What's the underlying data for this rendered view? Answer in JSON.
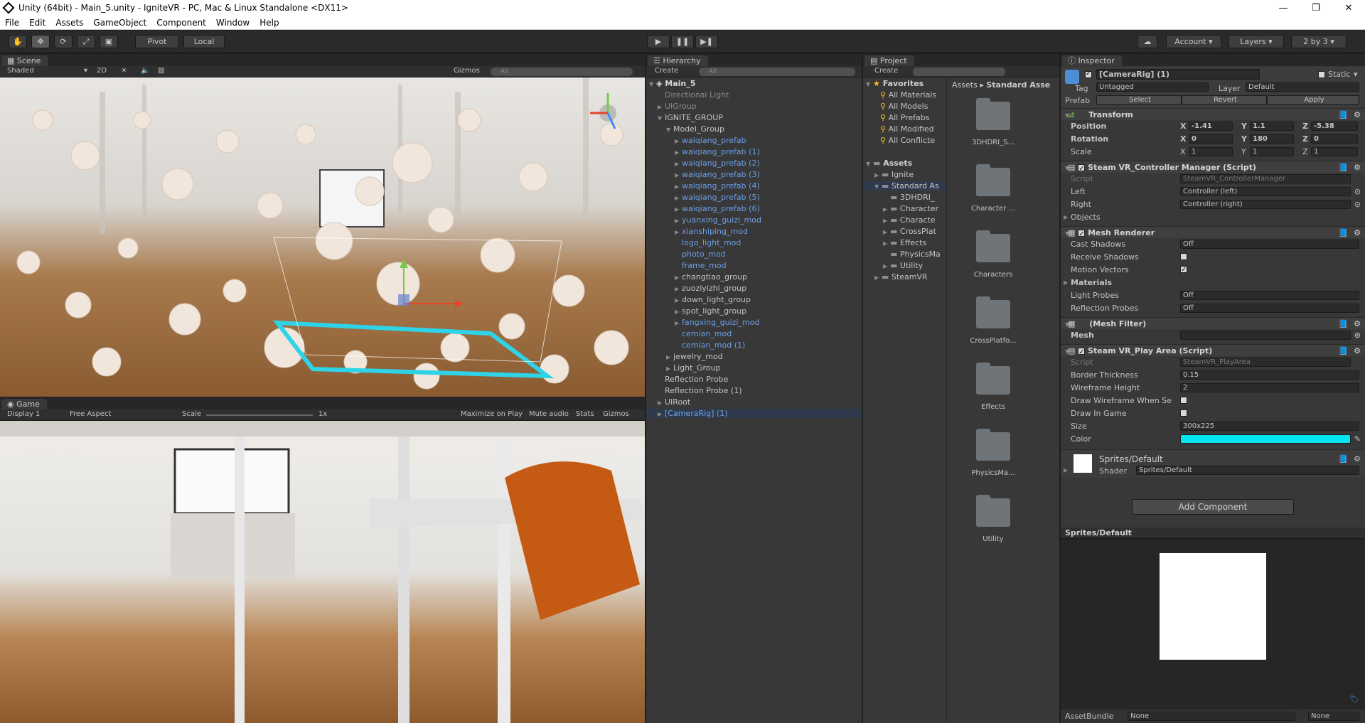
{
  "window": {
    "title": "Unity (64bit) - Main_5.unity - IgniteVR - PC, Mac & Linux Standalone <DX11>",
    "minimize": "—",
    "restore": "❐",
    "close": "✕"
  },
  "menu": [
    "File",
    "Edit",
    "Assets",
    "GameObject",
    "Component",
    "Window",
    "Help"
  ],
  "toolbar": {
    "pivot": "Pivot",
    "local": "Local",
    "account": "Account",
    "layers": "Layers",
    "layout": "2 by 3"
  },
  "scene": {
    "tab": "Scene",
    "shading": "Shaded",
    "mode2d": "2D",
    "gizmos": "Gizmos",
    "search_placeholder": "All"
  },
  "game": {
    "tab": "Game",
    "display": "Display 1",
    "aspect": "Free Aspect",
    "scale_label": "Scale",
    "scale_value": "1x",
    "maximize": "Maximize on Play",
    "mute": "Mute audio",
    "stats": "Stats",
    "gizmos": "Gizmos"
  },
  "hierarchy": {
    "tab": "Hierarchy",
    "create": "Create",
    "search_placeholder": "All",
    "scene_name": "Main_5",
    "rows": [
      {
        "label": "Directional Light",
        "color": "gray",
        "arrow": ""
      },
      {
        "label": "UIGroup",
        "color": "gray",
        "arrow": "▶"
      },
      {
        "label": "IGNITE_GROUP",
        "color": "normal",
        "arrow": "▼"
      },
      {
        "label": "Model_Group",
        "color": "normal",
        "arrow": "▼"
      },
      {
        "label": "waiqiang_prefab",
        "color": "blue",
        "arrow": "▶"
      },
      {
        "label": "waiqiang_prefab (1)",
        "color": "blue",
        "arrow": "▶"
      },
      {
        "label": "waiqiang_prefab (2)",
        "color": "blue",
        "arrow": "▶"
      },
      {
        "label": "waiqiang_prefab (3)",
        "color": "blue",
        "arrow": "▶"
      },
      {
        "label": "waiqiang_prefab (4)",
        "color": "blue",
        "arrow": "▶"
      },
      {
        "label": "waiqiang_prefab (5)",
        "color": "blue",
        "arrow": "▶"
      },
      {
        "label": "waiqiang_prefab (6)",
        "color": "blue",
        "arrow": "▶"
      },
      {
        "label": "yuanxing_guizi_mod",
        "color": "blue",
        "arrow": "▶"
      },
      {
        "label": "xianshiping_mod",
        "color": "blue",
        "arrow": "▶"
      },
      {
        "label": "logo_light_mod",
        "color": "blue",
        "arrow": ""
      },
      {
        "label": "photo_mod",
        "color": "blue",
        "arrow": ""
      },
      {
        "label": "frame_mod",
        "color": "blue",
        "arrow": ""
      },
      {
        "label": "changtiao_group",
        "color": "normal",
        "arrow": "▶"
      },
      {
        "label": "zuoziyizhi_group",
        "color": "normal",
        "arrow": "▶"
      },
      {
        "label": "down_light_group",
        "color": "normal",
        "arrow": "▶"
      },
      {
        "label": "spot_light_group",
        "color": "normal",
        "arrow": "▶"
      },
      {
        "label": "fangxing_guizi_mod",
        "color": "blue",
        "arrow": "▶"
      },
      {
        "label": "cemian_mod",
        "color": "blue",
        "arrow": ""
      },
      {
        "label": "cemian_mod (1)",
        "color": "blue",
        "arrow": ""
      },
      {
        "label": "jewelry_mod",
        "color": "normal",
        "arrow": "▶"
      },
      {
        "label": "Light_Group",
        "color": "normal",
        "arrow": "▶"
      },
      {
        "label": "Reflection Probe",
        "color": "normal",
        "arrow": ""
      },
      {
        "label": "Reflection Probe (1)",
        "color": "normal",
        "arrow": ""
      },
      {
        "label": "UIRoot",
        "color": "normal",
        "arrow": "▶"
      },
      {
        "label": "[CameraRig] (1)",
        "color": "blue",
        "arrow": "▶"
      }
    ]
  },
  "project": {
    "tab": "Project",
    "create": "Create",
    "favorites_title": "Favorites",
    "favorites": [
      "All Materials",
      "All Models",
      "All Prefabs",
      "All Modified",
      "All Conflicte"
    ],
    "assets_title": "Assets",
    "assets": [
      {
        "label": "Ignite",
        "arrow": "▶"
      },
      {
        "label": "Standard As",
        "arrow": "▼"
      },
      {
        "label": "3DHDRI_",
        "arrow": ""
      },
      {
        "label": "Character",
        "arrow": "▶"
      },
      {
        "label": "Characte",
        "arrow": "▶"
      },
      {
        "label": "CrossPlat",
        "arrow": "▶"
      },
      {
        "label": "Effects",
        "arrow": "▶"
      },
      {
        "label": "PhysicsMa",
        "arrow": ""
      },
      {
        "label": "Utility",
        "arrow": "▶"
      },
      {
        "label": "SteamVR",
        "arrow": "▶"
      }
    ],
    "breadcrumb_root": "Assets",
    "breadcrumb_sep": "▸",
    "breadcrumb_current": "Standard Asse",
    "folders": [
      "3DHDRI_S...",
      "Character ...",
      "Characters",
      "CrossPlatfo...",
      "Effects",
      "PhysicsMa...",
      "Utility"
    ]
  },
  "inspector": {
    "tab": "Inspector",
    "object_name": "[CameraRig] (1)",
    "static_label": "Static",
    "tag_label": "Tag",
    "tag_value": "Untagged",
    "layer_label": "Layer",
    "layer_value": "Default",
    "prefab_label": "Prefab",
    "prefab_select": "Select",
    "prefab_revert": "Revert",
    "prefab_apply": "Apply",
    "transform": {
      "title": "Transform",
      "position_label": "Position",
      "px": "-1.41",
      "py": "1.1",
      "pz": "-5.38",
      "rotation_label": "Rotation",
      "rx": "0",
      "ry": "180",
      "rz": "0",
      "scale_label": "Scale",
      "sx": "1",
      "sy": "1",
      "sz": "1"
    },
    "controller": {
      "title": "Steam VR_Controller Manager (Script)",
      "script_label": "Script",
      "script_value": "SteamVR_ControllerManager",
      "left_label": "Left",
      "left_value": "Controller (left)",
      "right_label": "Right",
      "right_value": "Controller (right)",
      "objects_label": "Objects"
    },
    "mesh_renderer": {
      "title": "Mesh Renderer",
      "cast_label": "Cast Shadows",
      "cast_value": "Off",
      "receive_label": "Receive Shadows",
      "motion_label": "Motion Vectors",
      "materials_label": "Materials",
      "light_label": "Light Probes",
      "light_value": "Off",
      "reflection_label": "Reflection Probes",
      "reflection_value": "Off"
    },
    "mesh_filter": {
      "title": "(Mesh Filter)",
      "mesh_label": "Mesh"
    },
    "play_area": {
      "title": "Steam VR_Play Area (Script)",
      "script_label": "Script",
      "script_value": "SteamVR_PlayArea",
      "border_label": "Border Thickness",
      "border_value": "0.15",
      "wire_label": "Wireframe Height",
      "wire_value": "2",
      "draw_wire_label": "Draw Wireframe When Se",
      "draw_game_label": "Draw In Game",
      "size_label": "Size",
      "size_value": "300x225",
      "color_label": "Color",
      "color_hex": "#00e5ee"
    },
    "material": {
      "name": "Sprites/Default",
      "shader_label": "Shader",
      "shader_value": "Sprites/Default"
    },
    "add_component": "Add Component",
    "preview_title": "Sprites/Default",
    "assetbundle_label": "AssetBundle",
    "assetbundle_value": "None",
    "assetbundle_variant": "None"
  }
}
